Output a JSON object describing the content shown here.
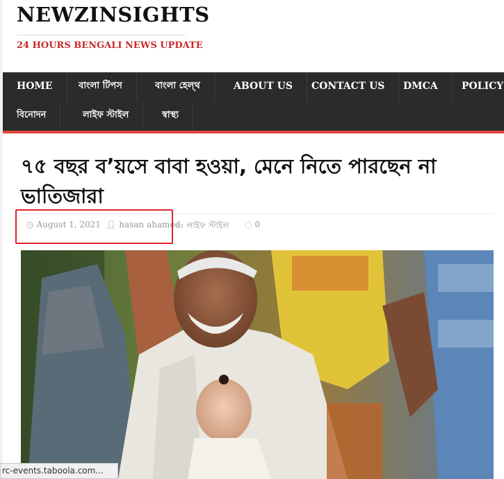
{
  "site": {
    "title": "NEWZINSIGHTS",
    "tagline": "24 HOURS BENGALI NEWS UPDATE"
  },
  "nav": {
    "items": [
      {
        "label": "HOME"
      },
      {
        "label": "বাংলা টিপস"
      },
      {
        "label": "বাংলা হেল্থ"
      },
      {
        "label": "ABOUT US"
      },
      {
        "label": "CONTACT US"
      },
      {
        "label": "DMCA"
      },
      {
        "label": "POLICY"
      },
      {
        "label": "বিনোদন"
      },
      {
        "label": "লাইফ স্টাইল"
      },
      {
        "label": "স্বাস্থ্য"
      }
    ]
  },
  "article": {
    "title": "৭৫ বছর ব’য়সে বাবা হওয়া, মেনে নিতে পারছেন না ভাতিজারা",
    "date": "August 1, 2021",
    "author": "hasan ahamed",
    "category": "লাইফ স্টাইল",
    "comments": "0"
  },
  "icons": {
    "date": "clock-icon",
    "author": "user-icon",
    "category": "folder-open-icon",
    "comments": "comment-icon"
  },
  "status_bar": {
    "text": "rc-events.taboola.com..."
  },
  "colors": {
    "accent": "#c8282b",
    "nav_bg": "#2b2b2b",
    "nav_border": "#e4473f",
    "highlight": "#d9252a"
  }
}
